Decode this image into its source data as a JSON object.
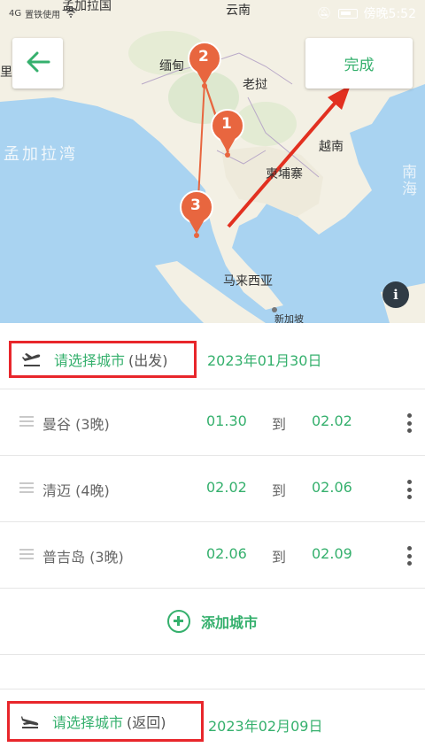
{
  "status_bar": {
    "signal": "4G",
    "carrier_text": "置铁使用",
    "time": "傍晚5:52"
  },
  "map": {
    "back_icon": "arrow-left-icon",
    "done_label": "完成",
    "info_icon": "info-icon",
    "info_label": "i",
    "labels": {
      "bangladesh": "孟加拉国",
      "yunnan": "云南",
      "myanmar": "缅甸",
      "laos": "老挝",
      "bay_of_bengal": "孟加拉湾",
      "vietnam": "越南",
      "cambodia": "柬埔寨",
      "malaysia": "马来西亚",
      "singapore": "新加坡",
      "south_china_sea": "南海",
      "partial_left": "里"
    },
    "markers": [
      {
        "number": "1"
      },
      {
        "number": "2"
      },
      {
        "number": "3"
      }
    ]
  },
  "trip": {
    "departure": {
      "icon": "plane-takeoff-icon",
      "pick_label": "请选择城市",
      "suffix": "(出发)",
      "date": "2023年01月30日"
    },
    "cities": [
      {
        "name": "曼谷 (3晚)",
        "from": "01.30",
        "to_word": "到",
        "to": "02.02"
      },
      {
        "name": "清迈 (4晚)",
        "from": "02.02",
        "to_word": "到",
        "to": "02.06"
      },
      {
        "name": "普吉岛 (3晚)",
        "from": "02.06",
        "to_word": "到",
        "to": "02.09"
      }
    ],
    "add_city_label": "添加城市",
    "return": {
      "icon": "plane-landing-icon",
      "pick_label": "请选择城市",
      "suffix": "(返回)",
      "date": "2023年02月09日"
    }
  },
  "colors": {
    "accent": "#35b06d",
    "highlight_box": "#e8262b",
    "marker": "#e8663f",
    "route": "#e04a1f"
  }
}
